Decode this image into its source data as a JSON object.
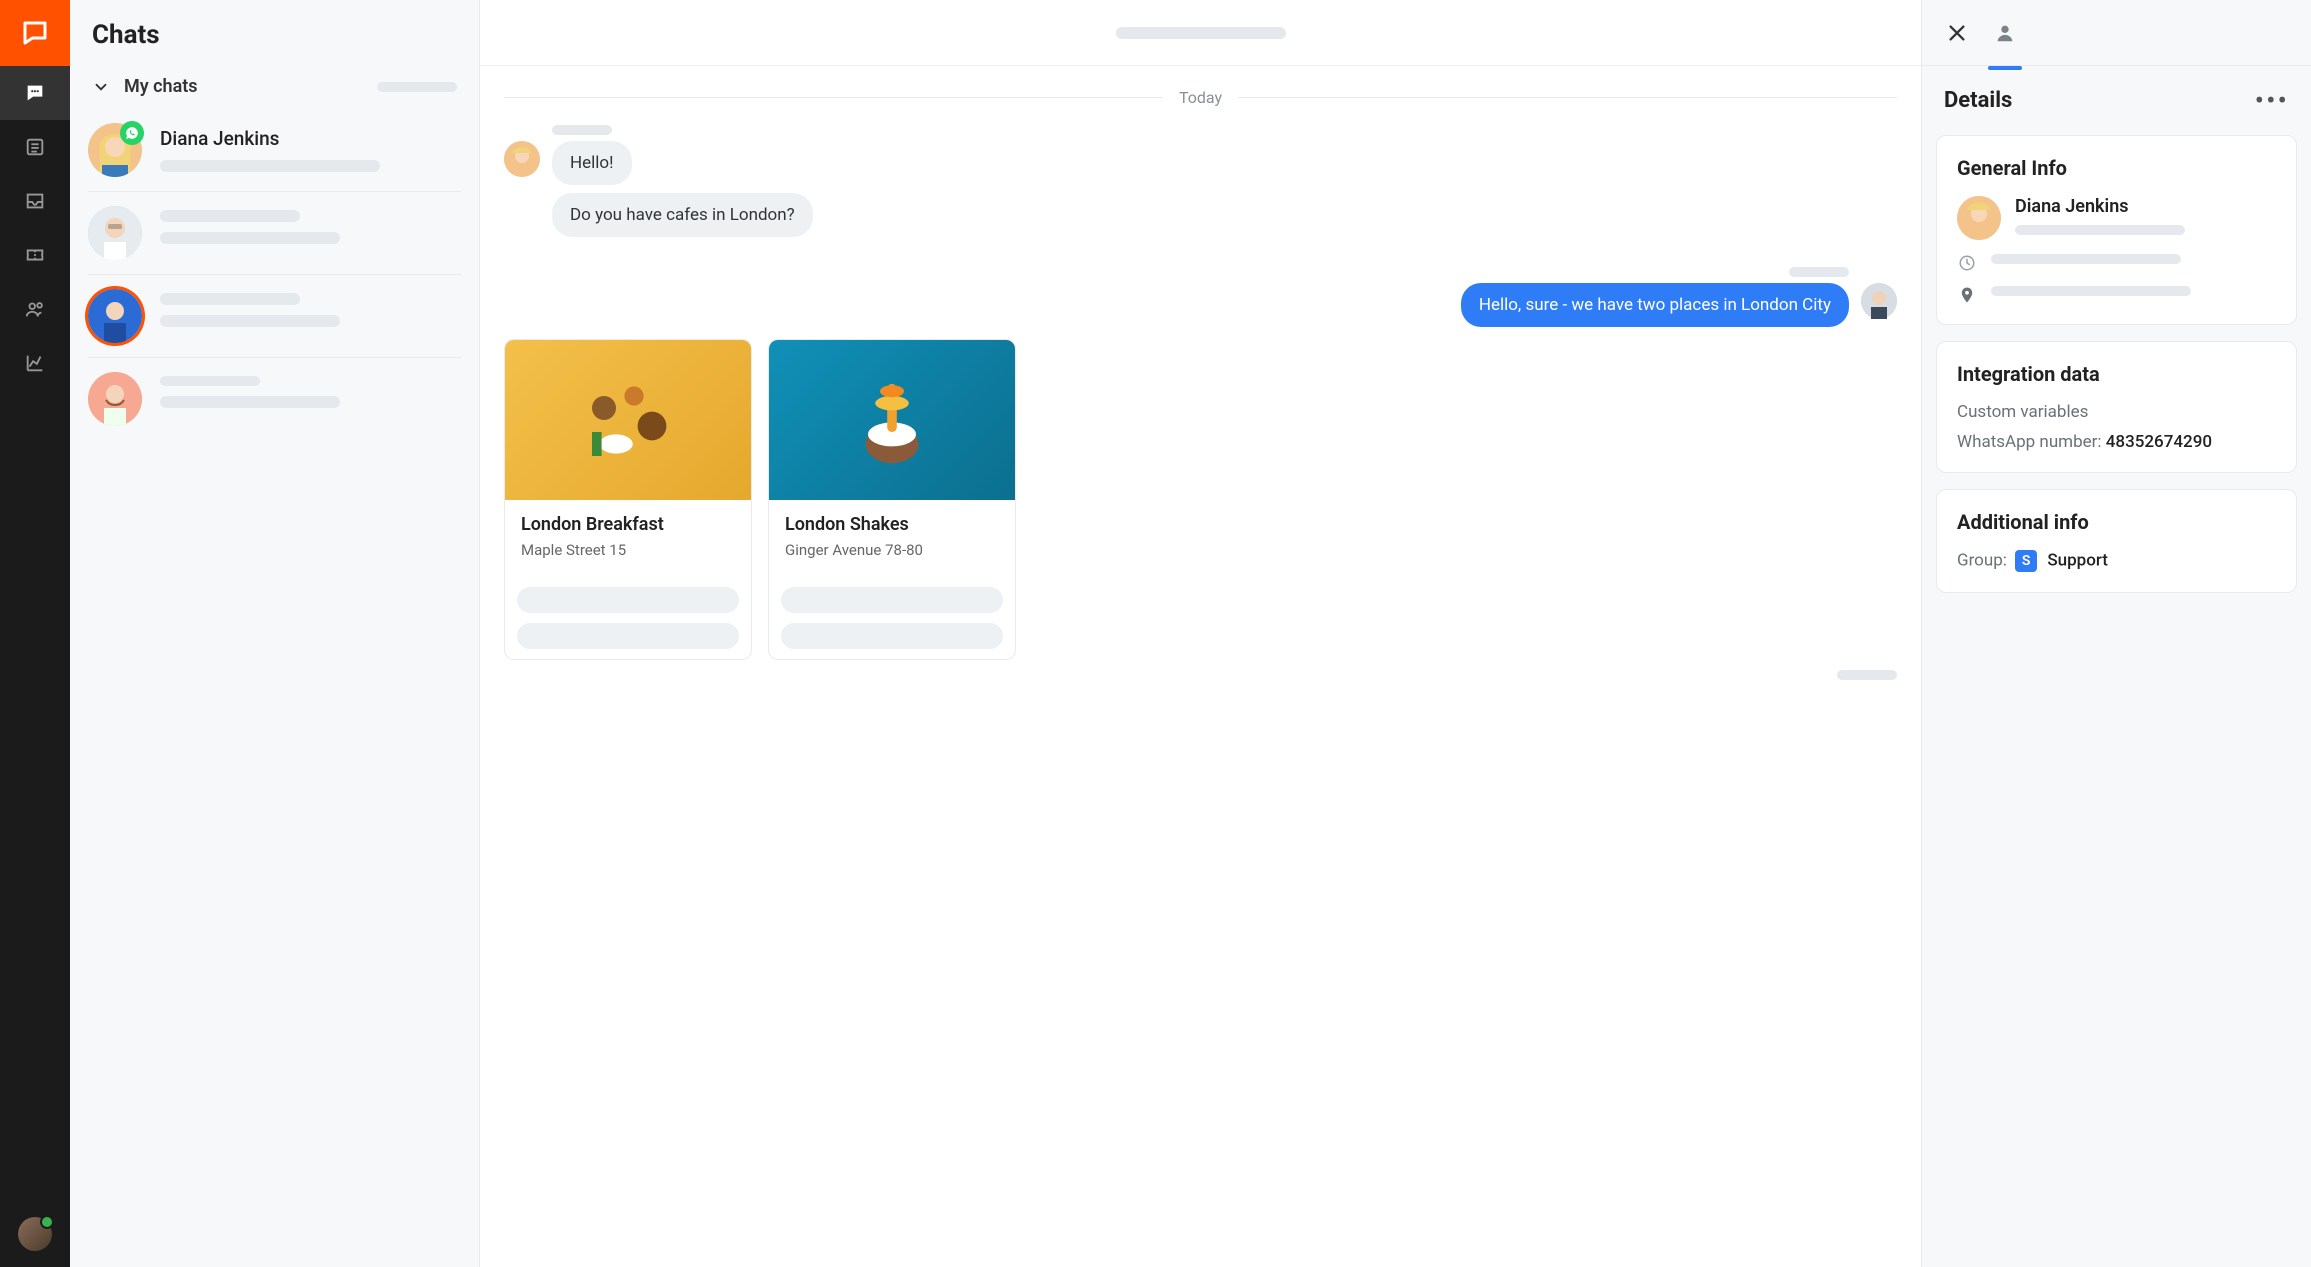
{
  "header": {
    "title": "Chats"
  },
  "section": {
    "title": "My chats"
  },
  "chats": {
    "first_name": "Diana Jenkins"
  },
  "conversation": {
    "divider": "Today",
    "in1": "Hello!",
    "in2": "Do you have cafes in London?",
    "out1": "Hello, sure - we have two places in London City"
  },
  "cards": [
    {
      "title": "London Breakfast",
      "subtitle": "Maple Street 15"
    },
    {
      "title": "London Shakes",
      "subtitle": "Ginger Avenue 78-80"
    }
  ],
  "details": {
    "title": "Details",
    "general": {
      "heading": "General Info",
      "name": "Diana Jenkins"
    },
    "integration": {
      "heading": "Integration data",
      "custom_label": "Custom variables",
      "whatsapp_label": "WhatsApp number: ",
      "whatsapp_value": "48352674290"
    },
    "additional": {
      "heading": "Additional info",
      "group_label": "Group:",
      "group_badge": "S",
      "group_value": "Support"
    }
  }
}
